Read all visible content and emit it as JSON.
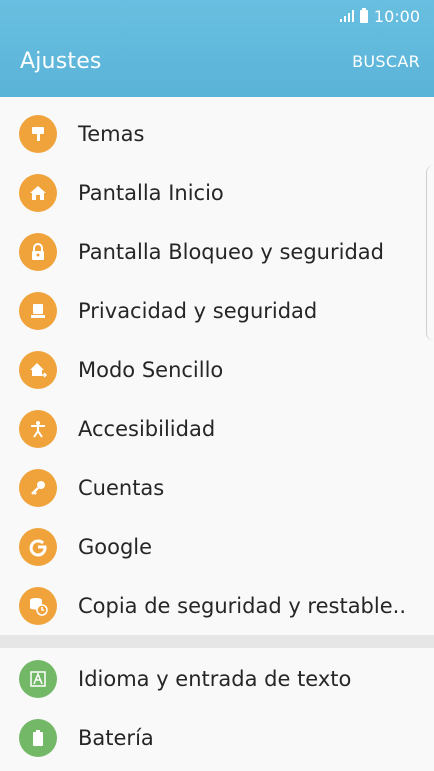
{
  "status_bar": {
    "time": "10:00"
  },
  "header": {
    "title": "Ajustes",
    "search_label": "BUSCAR"
  },
  "sections": {
    "main": [
      {
        "label": "Temas",
        "icon": "paint-roller-icon"
      },
      {
        "label": "Pantalla Inicio",
        "icon": "home-icon"
      },
      {
        "label": "Pantalla Bloqueo y seguridad",
        "icon": "lock-icon"
      },
      {
        "label": "Privacidad y seguridad",
        "icon": "privacy-icon"
      },
      {
        "label": "Modo Sencillo",
        "icon": "easy-mode-icon"
      },
      {
        "label": "Accesibilidad",
        "icon": "accessibility-icon"
      },
      {
        "label": "Cuentas",
        "icon": "key-icon"
      },
      {
        "label": "Google",
        "icon": "google-icon"
      },
      {
        "label": "Copia de seguridad y restable..",
        "icon": "backup-icon"
      }
    ],
    "secondary": [
      {
        "label": "Idioma y entrada de texto",
        "icon": "language-icon"
      },
      {
        "label": "Batería",
        "icon": "battery-icon"
      }
    ]
  },
  "colors": {
    "header": "#5ab3d8",
    "orange_icon": "#f0a33b",
    "green_icon": "#72b867"
  }
}
